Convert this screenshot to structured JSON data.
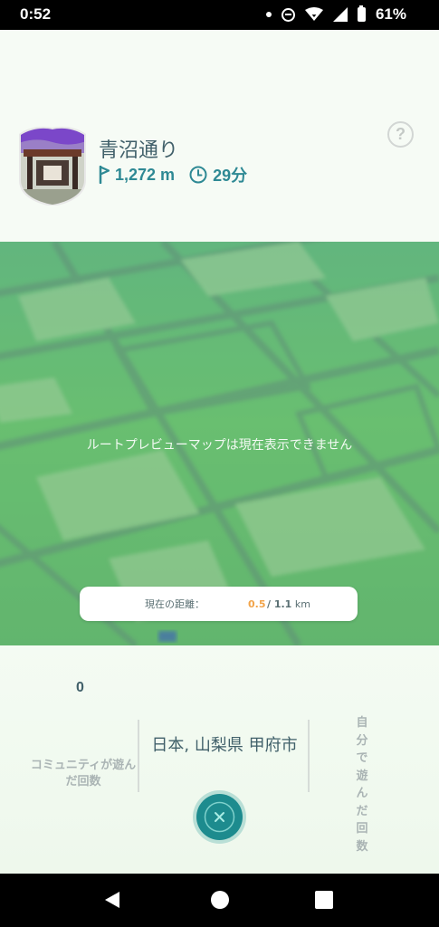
{
  "status_bar": {
    "time": "0:52",
    "battery": "61%"
  },
  "header": {
    "help_label": "?",
    "route_title": "青沼通り",
    "distance": "1,272 m",
    "duration": "29分"
  },
  "map": {
    "message": "ルートプレビューマップは現在表示できません",
    "distance_pill": {
      "label": "現在の距離：",
      "current": "0.5",
      "separator_total": "/ 1.1",
      "unit": "km"
    }
  },
  "stats": {
    "community_count": "0",
    "community_label": "コミュニティが遊んだ回数",
    "location": "日本, 山梨県 甲府市",
    "self_label": "自分で遊んだ回数"
  },
  "colors": {
    "accent": "#2e8994",
    "close_button": "#1d8b8e",
    "distance_current": "#f2a44a"
  },
  "icons": [
    "flag-icon",
    "clock-icon",
    "help-icon",
    "close-icon",
    "back-icon",
    "home-icon",
    "recents-icon",
    "wifi-icon",
    "signal-icon",
    "dnd-icon",
    "battery-icon"
  ]
}
